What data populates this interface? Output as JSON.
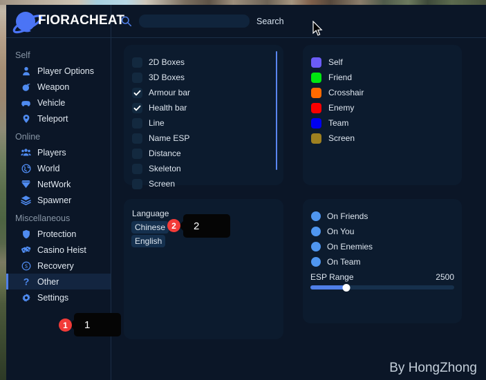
{
  "brand": {
    "name": "FIORACHEAT",
    "logo_icon": "planet-logo-icon"
  },
  "search": {
    "value": "",
    "placeholder": "",
    "label": "Search",
    "icon": "search-icon"
  },
  "sidebar": {
    "groups": [
      {
        "title": "Self",
        "items": [
          {
            "label": "Player Options",
            "icon": "person-icon"
          },
          {
            "label": "Weapon",
            "icon": "grenade-icon"
          },
          {
            "label": "Vehicle",
            "icon": "car-icon"
          },
          {
            "label": "Teleport",
            "icon": "map-pin-icon"
          }
        ]
      },
      {
        "title": "Online",
        "items": [
          {
            "label": "Players",
            "icon": "people-icon"
          },
          {
            "label": "World",
            "icon": "globe-icon"
          },
          {
            "label": "NetWork",
            "icon": "diamond-icon"
          },
          {
            "label": "Spawner",
            "icon": "layers-icon"
          }
        ]
      },
      {
        "title": "Miscellaneous",
        "items": [
          {
            "label": "Protection",
            "icon": "shield-icon"
          },
          {
            "label": "Casino Heist",
            "icon": "dice-icon"
          },
          {
            "label": "Recovery",
            "icon": "dollar-circle-icon"
          },
          {
            "label": "Other",
            "icon": "question-mark-icon",
            "active": true,
            "badge": "1",
            "tooltip": "1"
          },
          {
            "label": "Settings",
            "icon": "gear-icon"
          }
        ]
      }
    ]
  },
  "esp_panel": {
    "items": [
      {
        "label": "2D Boxes",
        "checked": false
      },
      {
        "label": "3D Boxes",
        "checked": false
      },
      {
        "label": "Armour bar",
        "checked": true
      },
      {
        "label": "Health bar",
        "checked": true
      },
      {
        "label": "Line",
        "checked": false
      },
      {
        "label": "Name ESP",
        "checked": false
      },
      {
        "label": "Distance",
        "checked": false
      },
      {
        "label": "Skeleton",
        "checked": false
      },
      {
        "label": "Screen",
        "checked": false
      }
    ]
  },
  "color_panel": {
    "items": [
      {
        "label": "Self",
        "color": "#6b5cf6"
      },
      {
        "label": "Friend",
        "color": "#00e810"
      },
      {
        "label": "Crosshair",
        "color": "#ff6a00"
      },
      {
        "label": "Enemy",
        "color": "#fa0000"
      },
      {
        "label": "Team",
        "color": "#0000f0"
      },
      {
        "label": "Screen",
        "color": "#9e8020"
      }
    ]
  },
  "language_panel": {
    "title": "Language",
    "options": [
      {
        "label": "Chinese",
        "badge": "2",
        "tooltip": "2"
      },
      {
        "label": "English"
      }
    ]
  },
  "radio_panel": {
    "items": [
      {
        "label": "On Friends"
      },
      {
        "label": "On You"
      },
      {
        "label": "On Enemies"
      },
      {
        "label": "On Team"
      }
    ],
    "slider": {
      "label": "ESP Range",
      "value": "2500",
      "percent": 25
    }
  },
  "watermark": "By HongZhong",
  "colors": {
    "accent": "#4f7fe8",
    "badge": "#f23b38",
    "panel": "#0c1b2e",
    "app_bg": "#0b1627"
  }
}
